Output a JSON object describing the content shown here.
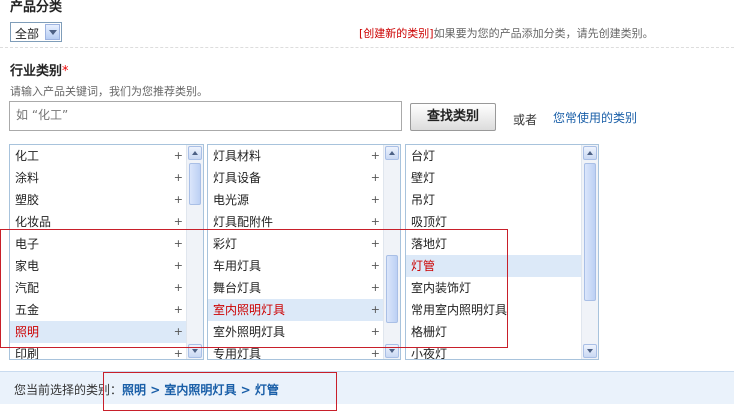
{
  "product_category": {
    "heading": "产品分类",
    "select_value": "全部",
    "create_link": "[创建新的类别]",
    "create_hint": "如果要为您的产品添加分类，请先创建类别。"
  },
  "industry": {
    "heading": "行业类别",
    "required_mark": "*",
    "hint": "请输入产品关键词，我们为您推荐类别。",
    "search_placeholder": "如 “化工”",
    "search_button": "查找类别",
    "or_text": "或者",
    "common_link": "您常使用的类别"
  },
  "columns": {
    "col1": [
      {
        "label": "化工",
        "plus": "+"
      },
      {
        "label": "涂料",
        "plus": "+"
      },
      {
        "label": "塑胶",
        "plus": "+"
      },
      {
        "label": "化妆品",
        "plus": "+"
      },
      {
        "label": "电子",
        "plus": "+"
      },
      {
        "label": "家电",
        "plus": "+"
      },
      {
        "label": "汽配",
        "plus": "+"
      },
      {
        "label": "五金",
        "plus": "+"
      },
      {
        "label": "照明",
        "plus": "+"
      },
      {
        "label": "印刷",
        "plus": "+"
      }
    ],
    "col2": [
      {
        "label": "灯具材料",
        "plus": "+"
      },
      {
        "label": "灯具设备",
        "plus": "+"
      },
      {
        "label": "电光源",
        "plus": "+"
      },
      {
        "label": "灯具配附件",
        "plus": "+"
      },
      {
        "label": "彩灯",
        "plus": "+"
      },
      {
        "label": "车用灯具",
        "plus": "+"
      },
      {
        "label": "舞台灯具",
        "plus": "+"
      },
      {
        "label": "室内照明灯具",
        "plus": "+"
      },
      {
        "label": "室外照明灯具",
        "plus": "+"
      },
      {
        "label": "专用灯具",
        "plus": "+"
      }
    ],
    "col3": [
      {
        "label": "台灯"
      },
      {
        "label": "壁灯"
      },
      {
        "label": "吊灯"
      },
      {
        "label": "吸顶灯"
      },
      {
        "label": "落地灯"
      },
      {
        "label": "灯管"
      },
      {
        "label": "室内装饰灯"
      },
      {
        "label": "常用室内照明灯具"
      },
      {
        "label": "格栅灯"
      },
      {
        "label": "小夜灯"
      }
    ]
  },
  "selection": {
    "selected_col1": 8,
    "selected_col2": 7,
    "selected_col3": 5
  },
  "current_selection": {
    "label": "您当前选择的类别：",
    "path": "照明 > 室内照明灯具 > 灯管"
  },
  "colors": {
    "accent_blue": "#1a5fa8",
    "alert_red": "#c81f2a",
    "selected_bg": "#dce9f8"
  }
}
